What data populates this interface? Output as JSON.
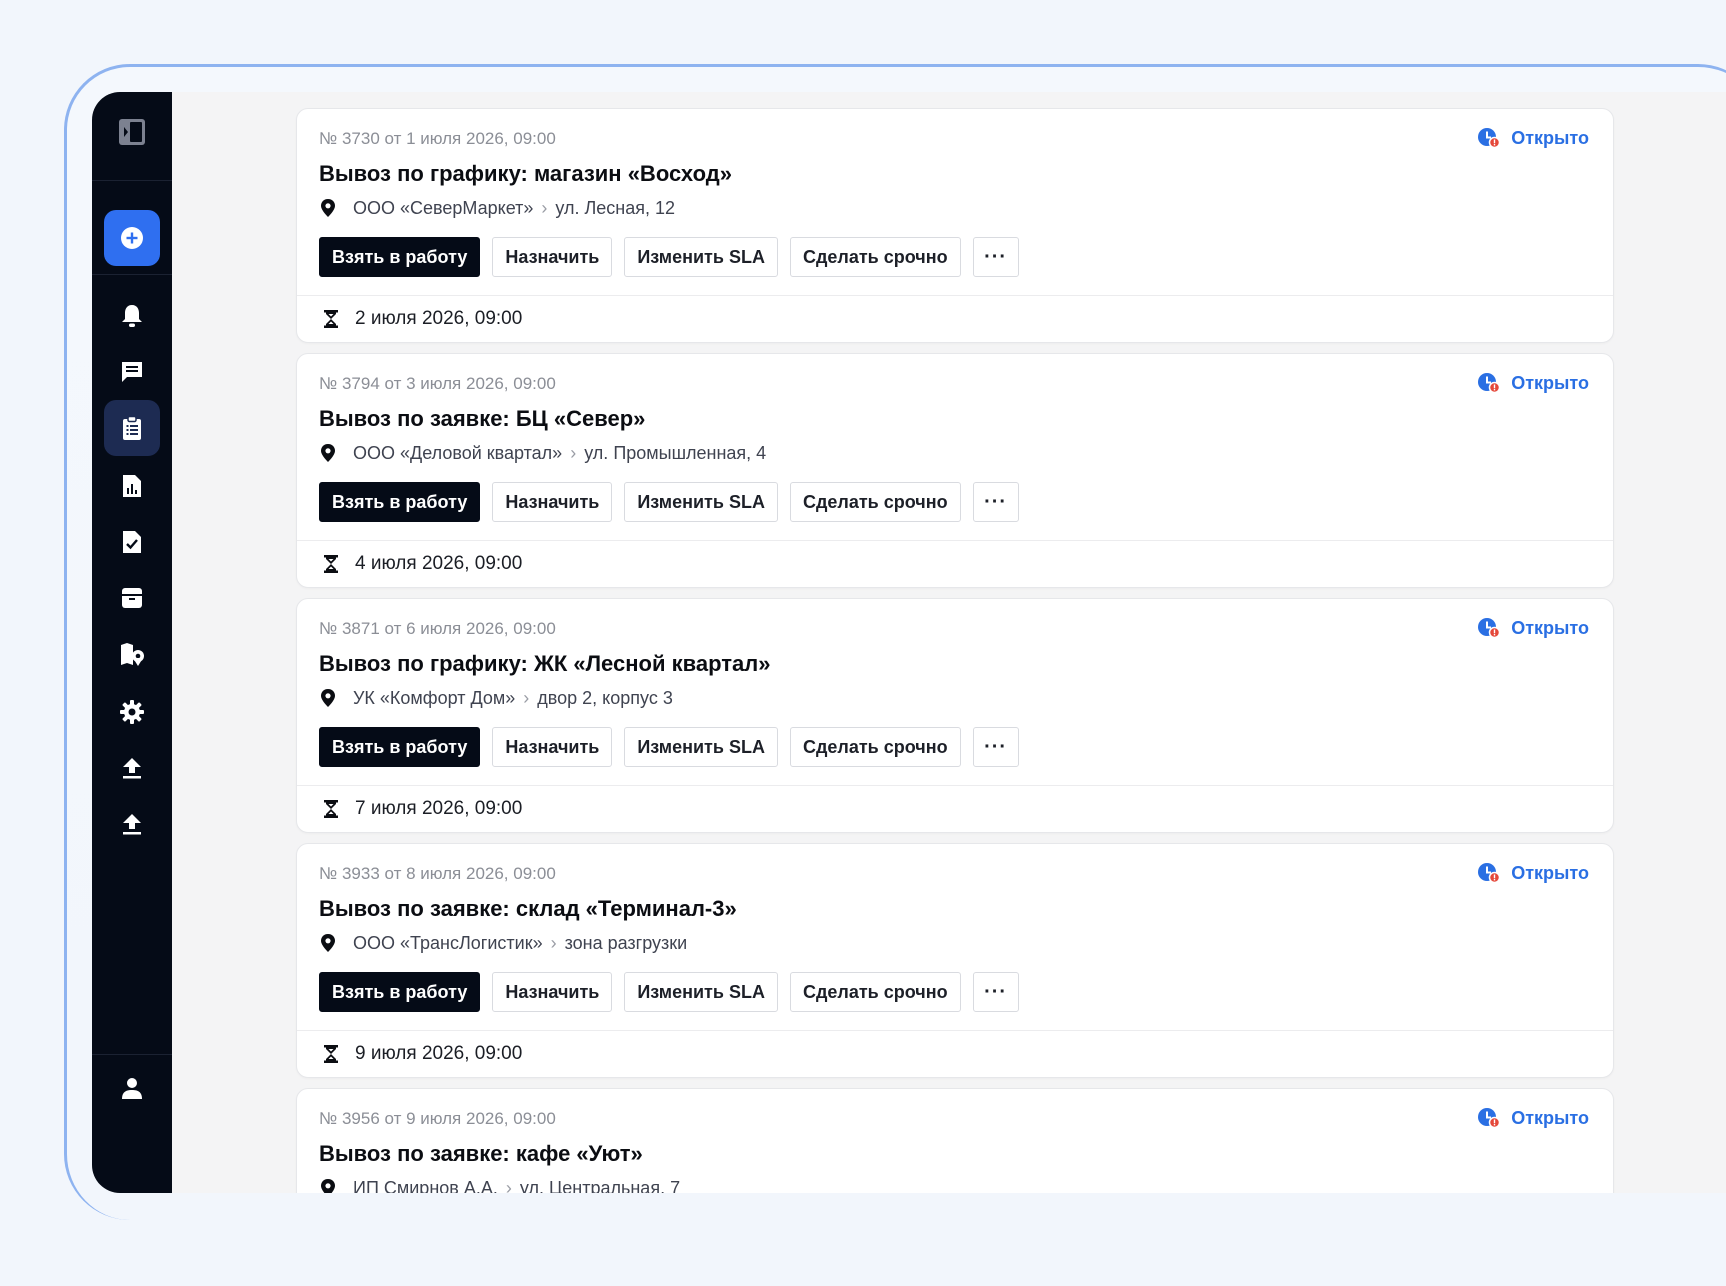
{
  "sidebar": {
    "toggle_icon": "panel-toggle-icon",
    "create_icon": "plus-circle-icon",
    "items": [
      {
        "icon": "bell-icon"
      },
      {
        "icon": "chat-icon"
      },
      {
        "icon": "clipboard-icon",
        "active": true
      },
      {
        "icon": "report-icon"
      },
      {
        "icon": "file-check-icon"
      },
      {
        "icon": "archive-icon"
      },
      {
        "icon": "map-icon"
      },
      {
        "icon": "gear-icon"
      },
      {
        "icon": "upload-icon"
      },
      {
        "icon": "upload-icon"
      }
    ],
    "profile_icon": "user-icon"
  },
  "colors": {
    "sidebar_bg": "#050b17",
    "create_button": "#2f6ff0",
    "active_item": "#1d2b52",
    "status_blue": "#2a6fe3",
    "status_dot_red": "#e5483a",
    "primary_button": "#050b17"
  },
  "actions": {
    "take": "Взять в работу",
    "assign": "Назначить",
    "change_sla": "Изменить SLA",
    "make_urgent": "Сделать срочно",
    "more": "···"
  },
  "tickets": [
    {
      "meta": "№ 3730 от 1 июля 2026, 09:00",
      "title": "Вывоз по графику: магазин «Восход»",
      "org": "ООО «СеверМаркет»",
      "place": "ул. Лесная, 12",
      "status": "Открыто",
      "deadline": "2 июля 2026, 09:00"
    },
    {
      "meta": "№ 3794 от 3 июля 2026, 09:00",
      "title": "Вывоз по заявке: БЦ «Север»",
      "org": "ООО «Деловой квартал»",
      "place": "ул. Промышленная, 4",
      "status": "Открыто",
      "deadline": "4 июля 2026, 09:00"
    },
    {
      "meta": "№ 3871 от 6 июля 2026, 09:00",
      "title": "Вывоз по графику: ЖК «Лесной квартал»",
      "org": "УК «Комфорт Дом»",
      "place": "двор 2, корпус 3",
      "status": "Открыто",
      "deadline": "7 июля 2026, 09:00"
    },
    {
      "meta": "№ 3933 от 8 июля 2026, 09:00",
      "title": "Вывоз по заявке: склад «Терминал-3»",
      "org": "ООО «ТрансЛогистик»",
      "place": "зона разгрузки",
      "status": "Открыто",
      "deadline": "9 июля 2026, 09:00"
    },
    {
      "meta": "№ 3956 от 9 июля 2026, 09:00",
      "title": "Вывоз по заявке: кафе «Уют»",
      "org": "ИП Смирнов А.А.",
      "place": "ул. Центральная, 7",
      "status": "Открыто",
      "deadline": ""
    }
  ]
}
